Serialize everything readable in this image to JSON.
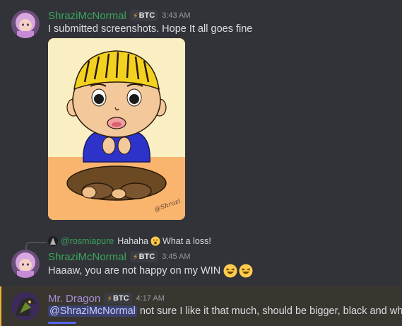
{
  "messages": [
    {
      "username": "ShraziMcNormal",
      "badge": "BTC",
      "time": "3:43 AM",
      "text": "I submitted screenshots. Hope It all goes fine",
      "image_signature": "@Shrazi"
    },
    {
      "reply": {
        "name": "@rosmiapure",
        "text_before": "Hahaha",
        "text_after": "What a loss!"
      },
      "username": "ShraziMcNormal",
      "badge": "BTC",
      "time": "3:45 AM",
      "text": "Haaaw, you are not happy on my WIN"
    },
    {
      "username": "Mr. Dragon",
      "badge": "BTC",
      "time": "4:17 AM",
      "mention": "@ShraziMcNormal",
      "text": " not sure I like it that much, should be bigger,  black and white"
    }
  ],
  "colors": {
    "background": "#313338",
    "username_green": "#3ba55c",
    "username_purple": "#a48fd6",
    "highlight": "#393630",
    "mention_bg": "#3c4270"
  }
}
